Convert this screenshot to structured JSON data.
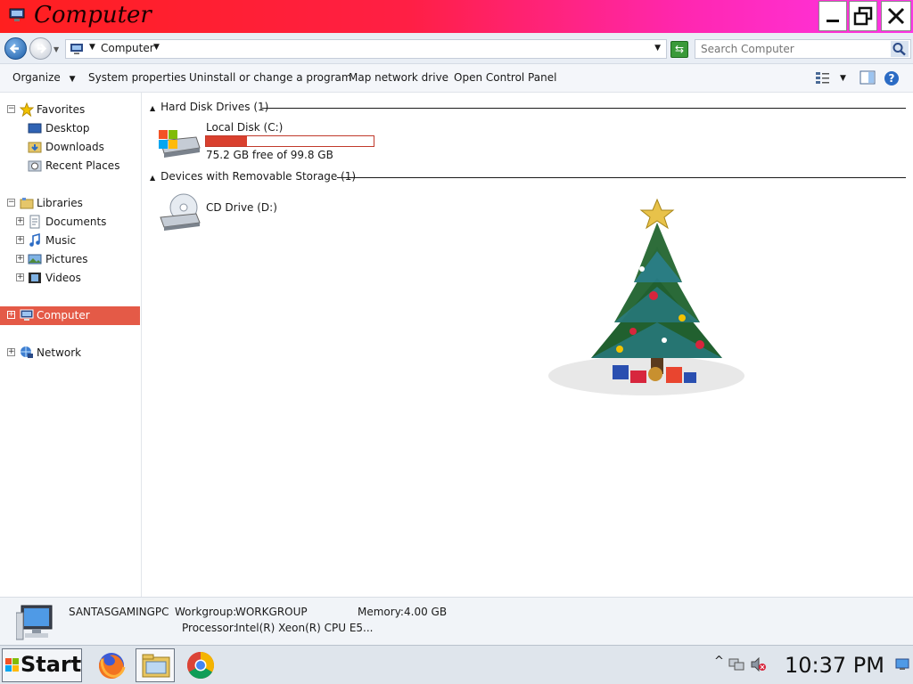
{
  "window": {
    "title": "Computer",
    "minimize_icon": "minimize-icon",
    "maximize_icon": "restore-icon",
    "close_icon": "close-icon",
    "titlebar_gradient": [
      "#ff1f1f",
      "#ff35e8"
    ]
  },
  "address_bar": {
    "location": "Computer",
    "search_placeholder": "Search Computer"
  },
  "toolbar": {
    "organize": "Organize",
    "system_properties": "System properties",
    "uninstall": "Uninstall or change a program",
    "map_drive": "Map network drive",
    "control_panel": "Open Control Panel"
  },
  "sidebar": {
    "favorites": "Favorites",
    "desktop": "Desktop",
    "downloads": "Downloads",
    "recent_places": "Recent Places",
    "libraries": "Libraries",
    "documents": "Documents",
    "music": "Music",
    "pictures": "Pictures",
    "videos": "Videos",
    "computer": "Computer",
    "network": "Network",
    "selected_color": "#e45a47"
  },
  "content": {
    "hdd_group": "Hard Disk Drives (1)",
    "local_disk_name": "Local Disk (C:)",
    "local_disk_free": "75.2 GB free of 99.8 GB",
    "local_disk_used_fraction": 0.246,
    "removable_group": "Devices with Removable Storage (1)",
    "cd_drive_name": "CD Drive (D:)"
  },
  "details": {
    "computer_name": "SANTASGAMINGPC",
    "workgroup_label": "Workgroup:",
    "workgroup_value": "WORKGROUP",
    "memory_label": "Memory:",
    "memory_value": "4.00 GB",
    "processor_label": "Processor:",
    "processor_value": "Intel(R) Xeon(R) CPU E5..."
  },
  "taskbar": {
    "start_label": "Start",
    "clock": "10:37 PM",
    "tray_expand": "^"
  }
}
